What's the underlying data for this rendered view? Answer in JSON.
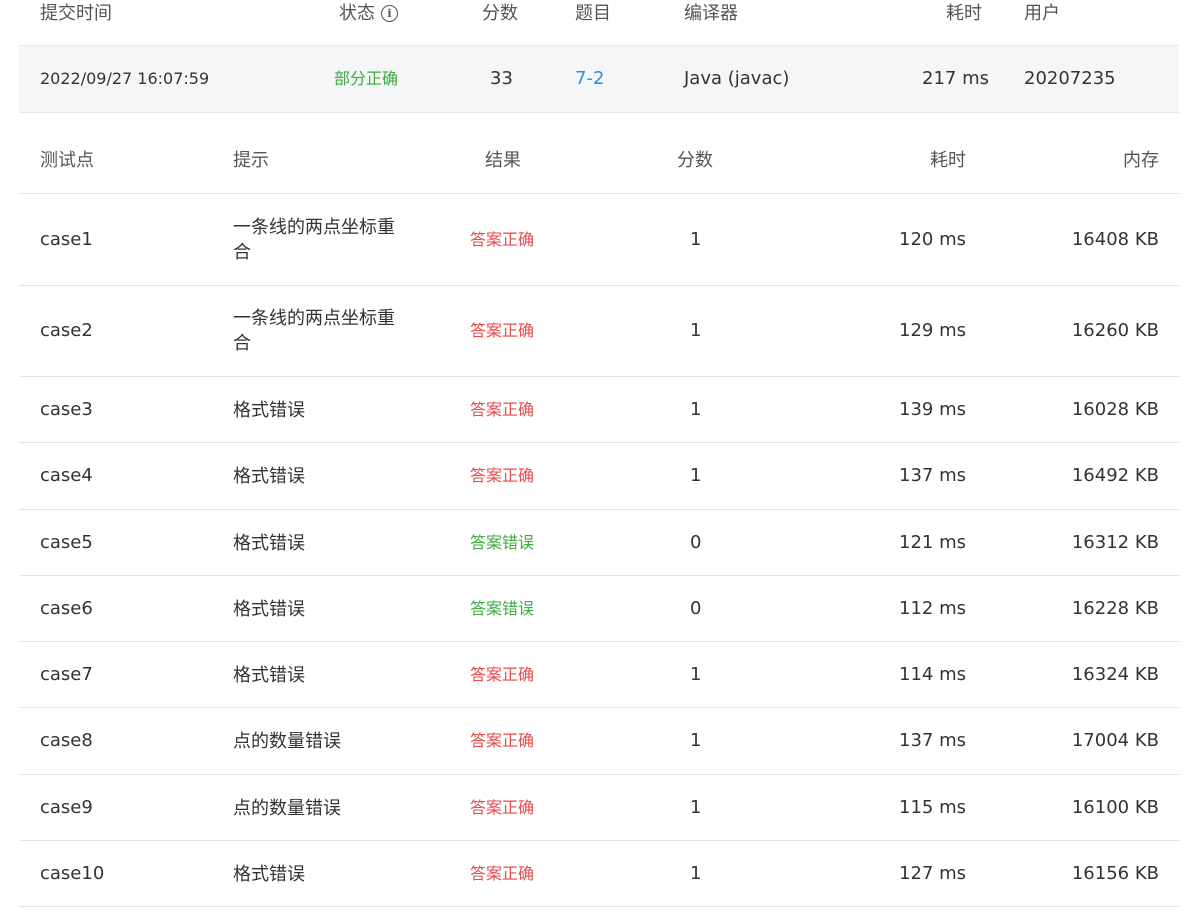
{
  "submission": {
    "headers": {
      "time": "提交时间",
      "status": "状态",
      "score": "分数",
      "problem": "题目",
      "compiler": "编译器",
      "elapsed": "耗时",
      "user": "用户"
    },
    "row": {
      "time": "2022/09/27 16:07:59",
      "status": "部分正确",
      "score": "33",
      "problem": "7-2",
      "compiler": "Java (javac)",
      "elapsed": "217 ms",
      "user": "20207235"
    }
  },
  "testcases": {
    "headers": {
      "case": "测试点",
      "hint": "提示",
      "result": "结果",
      "score": "分数",
      "elapsed": "耗时",
      "memory": "内存"
    },
    "rows": [
      {
        "case": "case1",
        "hint": "一条线的两点坐标重合",
        "result": "答案正确",
        "result_kind": "ok",
        "score": "1",
        "elapsed": "120 ms",
        "memory": "16408 KB"
      },
      {
        "case": "case2",
        "hint": "一条线的两点坐标重合",
        "result": "答案正确",
        "result_kind": "ok",
        "score": "1",
        "elapsed": "129 ms",
        "memory": "16260 KB"
      },
      {
        "case": "case3",
        "hint": "格式错误",
        "result": "答案正确",
        "result_kind": "ok",
        "score": "1",
        "elapsed": "139 ms",
        "memory": "16028 KB"
      },
      {
        "case": "case4",
        "hint": "格式错误",
        "result": "答案正确",
        "result_kind": "ok",
        "score": "1",
        "elapsed": "137 ms",
        "memory": "16492 KB"
      },
      {
        "case": "case5",
        "hint": "格式错误",
        "result": "答案错误",
        "result_kind": "wrong",
        "score": "0",
        "elapsed": "121 ms",
        "memory": "16312 KB"
      },
      {
        "case": "case6",
        "hint": "格式错误",
        "result": "答案错误",
        "result_kind": "wrong",
        "score": "0",
        "elapsed": "112 ms",
        "memory": "16228 KB"
      },
      {
        "case": "case7",
        "hint": "格式错误",
        "result": "答案正确",
        "result_kind": "ok",
        "score": "1",
        "elapsed": "114 ms",
        "memory": "16324 KB"
      },
      {
        "case": "case8",
        "hint": "点的数量错误",
        "result": "答案正确",
        "result_kind": "ok",
        "score": "1",
        "elapsed": "137 ms",
        "memory": "17004 KB"
      },
      {
        "case": "case9",
        "hint": "点的数量错误",
        "result": "答案正确",
        "result_kind": "ok",
        "score": "1",
        "elapsed": "115 ms",
        "memory": "16100 KB"
      },
      {
        "case": "case10",
        "hint": "格式错误",
        "result": "答案正确",
        "result_kind": "ok",
        "score": "1",
        "elapsed": "127 ms",
        "memory": "16156 KB"
      }
    ]
  },
  "colors": {
    "result_ok": "#e8494a",
    "result_wrong": "#3cab3c",
    "status_partial": "#3cab3c",
    "link": "#2c8ce6"
  }
}
